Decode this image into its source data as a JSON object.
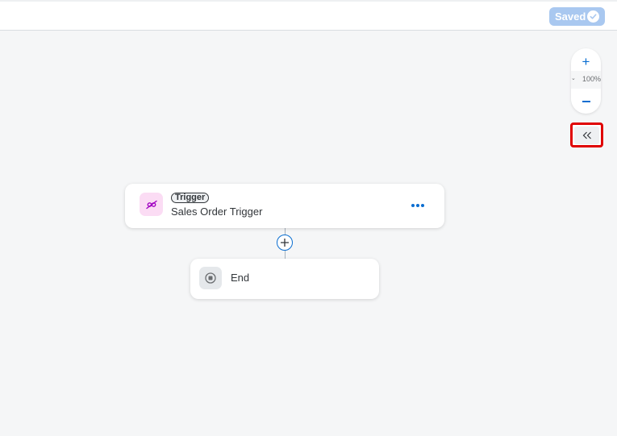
{
  "header": {
    "saved_label": "Saved",
    "saved_icon": "check-circle-icon"
  },
  "zoom": {
    "zoom_in_label": "+",
    "level": "100%",
    "zoom_out_icon": "minus-icon"
  },
  "panel_toggle": {
    "icon": "double-chevron-left-icon"
  },
  "flow": {
    "trigger": {
      "tag": "Trigger",
      "name": "Sales Order Trigger",
      "icon": "connection-icon",
      "more_icon": "overflow-icon"
    },
    "add_step_icon": "plus-circle-icon",
    "end": {
      "label": "End",
      "icon": "stop-icon"
    }
  },
  "colors": {
    "accent": "#0a6ed1",
    "saved_badge": "#a9c8f0",
    "trigger_icon_bg": "#fbdcf4",
    "trigger_icon_fg": "#a100c2",
    "highlight": "#e00000",
    "canvas": "#f5f6f7"
  }
}
